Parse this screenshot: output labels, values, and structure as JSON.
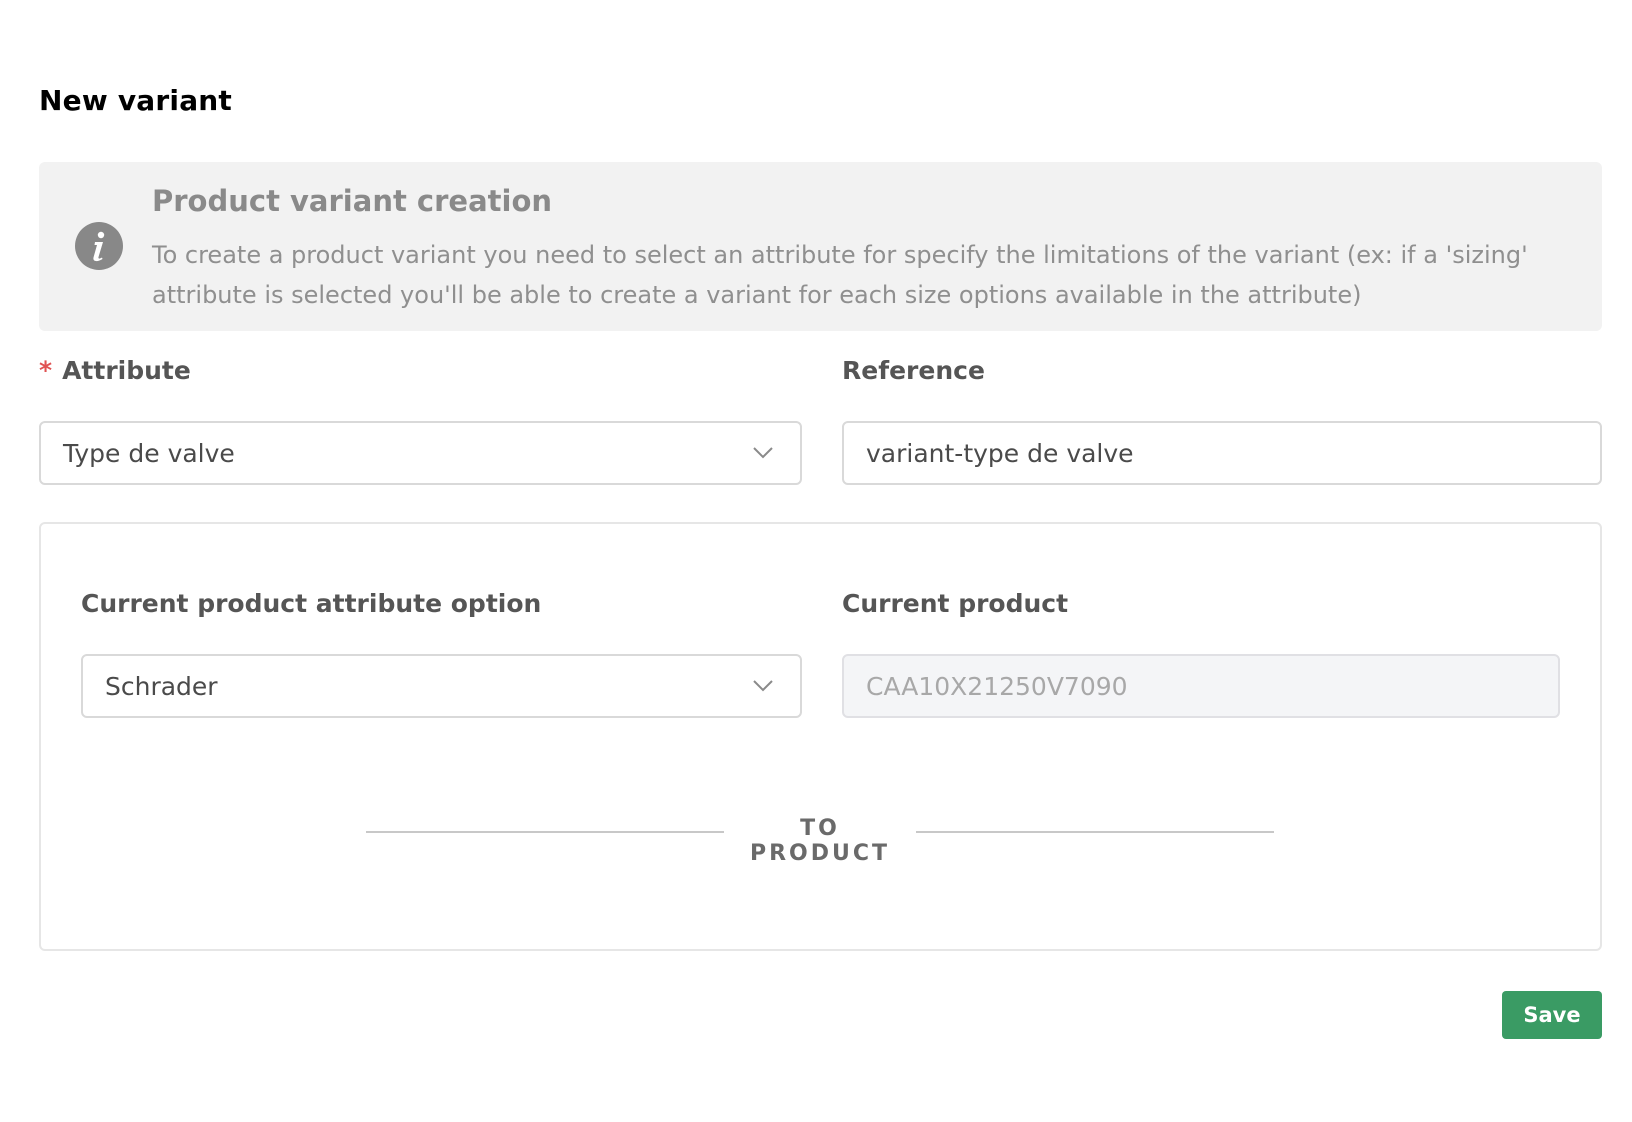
{
  "page": {
    "title": "New variant"
  },
  "info": {
    "icon": "info-icon",
    "title": "Product variant creation",
    "text": "To create a product variant you need to select an attribute for specify the limitations of the variant (ex: if a 'sizing' attribute is selected you'll be able to create a variant for each size options available in the attribute)"
  },
  "attribute": {
    "required_mark": "*",
    "label": "Attribute",
    "value": "Type de valve",
    "icon": "chevron-down-icon"
  },
  "reference": {
    "label": "Reference",
    "value": "variant-type de valve"
  },
  "current_option": {
    "label": "Current product attribute option",
    "value": "Schrader",
    "icon": "chevron-down-icon"
  },
  "current_product": {
    "label": "Current product",
    "value": "CAA10X21250V7090"
  },
  "divider": {
    "text": "TO PRODUCT"
  },
  "actions": {
    "save_label": "Save"
  },
  "colors": {
    "accent_green": "#3a9b64",
    "required_red": "#e05252",
    "info_background": "#f2f2f2"
  }
}
